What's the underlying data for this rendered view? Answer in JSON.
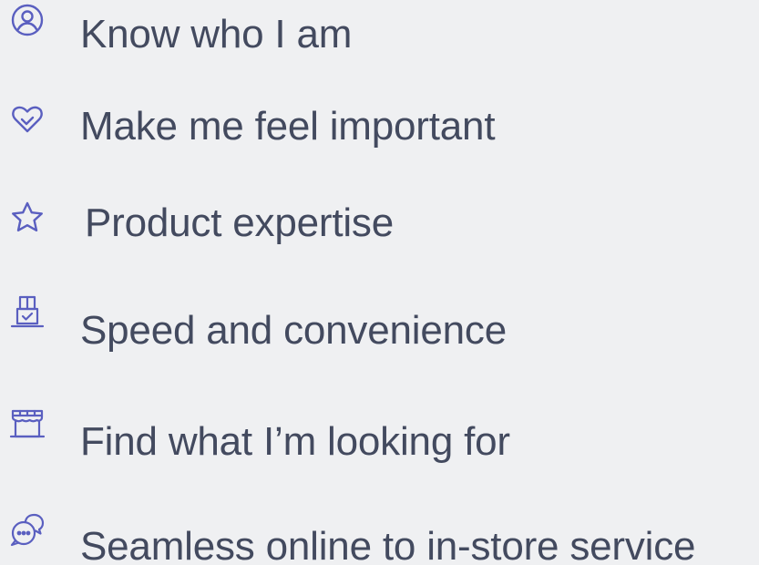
{
  "colors": {
    "background": "#eff0f2",
    "text": "#434a5f",
    "icon": "#5a5fc0"
  },
  "items": [
    {
      "icon": "user-circle-icon",
      "label": "Know who I am"
    },
    {
      "icon": "heart-icon",
      "label": "Make me feel important"
    },
    {
      "icon": "star-icon",
      "label": "Product expertise"
    },
    {
      "icon": "package-check-icon",
      "label": "Speed and convenience"
    },
    {
      "icon": "storefront-icon",
      "label": "Find what I’m looking for"
    },
    {
      "icon": "chat-bubbles-icon",
      "label": "Seamless online to in-store service"
    }
  ]
}
